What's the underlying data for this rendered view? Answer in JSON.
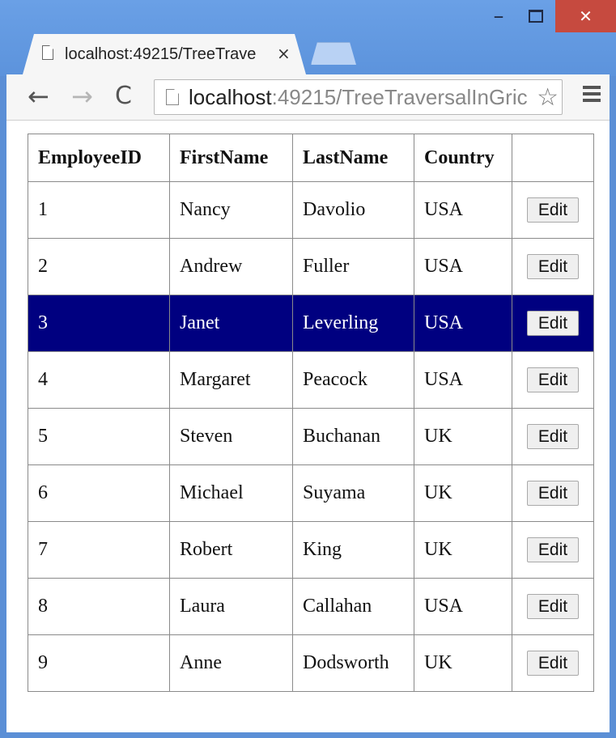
{
  "browser": {
    "tab_title": "localhost:49215/TreeTrave",
    "tab_close": "×",
    "url_host": "localhost",
    "url_rest": ":49215/TreeTraversalInGric",
    "window_min": "–",
    "window_close": "✕",
    "star": "☆",
    "back": "←",
    "forward": "→",
    "reload": "C"
  },
  "grid": {
    "headers": [
      "EmployeeID",
      "FirstName",
      "LastName",
      "Country",
      ""
    ],
    "edit_label": "Edit",
    "selected_row_index": 2,
    "rows": [
      [
        "1",
        "Nancy",
        "Davolio",
        "USA"
      ],
      [
        "2",
        "Andrew",
        "Fuller",
        "USA"
      ],
      [
        "3",
        "Janet",
        "Leverling",
        "USA"
      ],
      [
        "4",
        "Margaret",
        "Peacock",
        "USA"
      ],
      [
        "5",
        "Steven",
        "Buchanan",
        "UK"
      ],
      [
        "6",
        "Michael",
        "Suyama",
        "UK"
      ],
      [
        "7",
        "Robert",
        "King",
        "UK"
      ],
      [
        "8",
        "Laura",
        "Callahan",
        "USA"
      ],
      [
        "9",
        "Anne",
        "Dodsworth",
        "UK"
      ]
    ]
  },
  "colors": {
    "selected_row_bg": "#000080",
    "selected_row_text": "#ffffff",
    "window_close_bg": "#c64a3f"
  }
}
